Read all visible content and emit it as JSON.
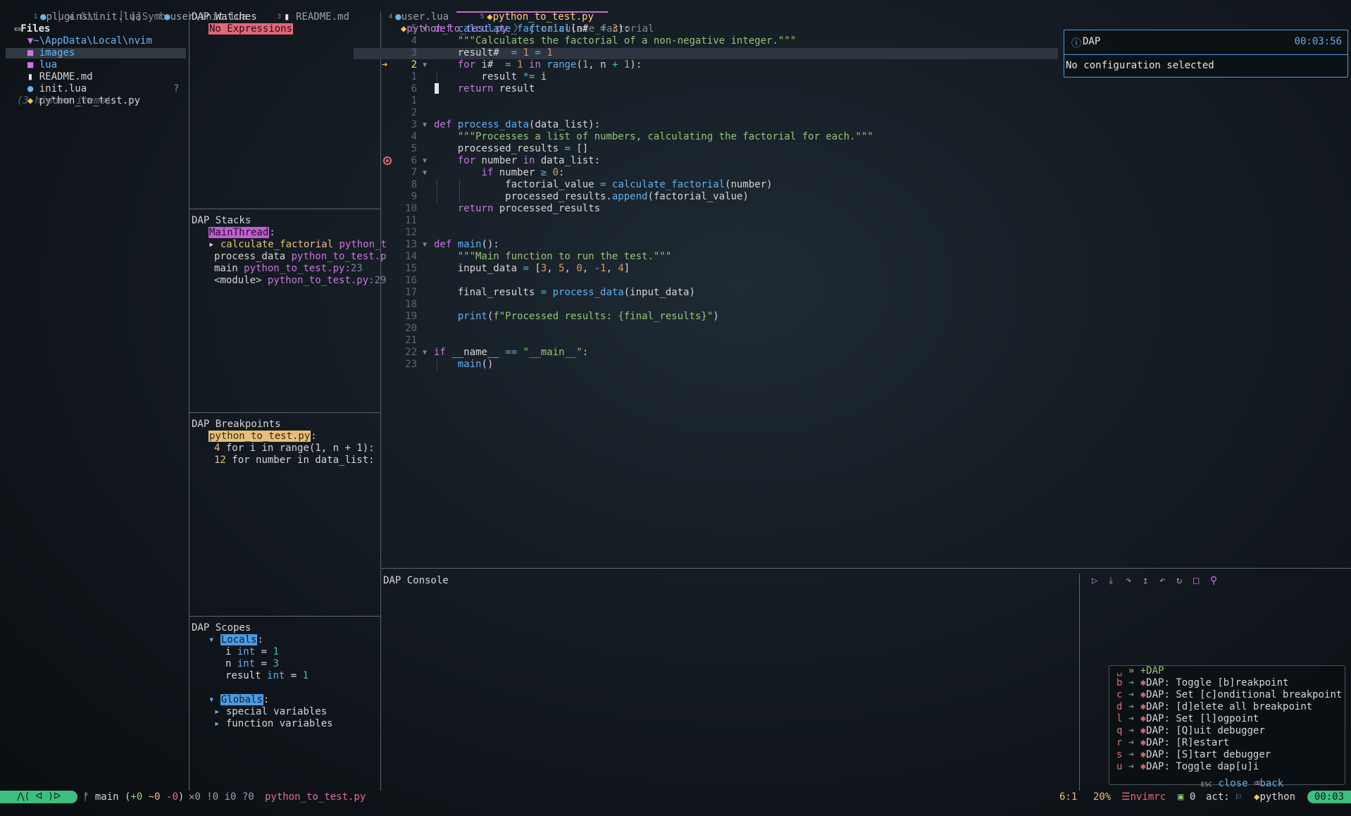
{
  "tabs": [
    {
      "num": "1",
      "icon": "lua-icon",
      "label": "plugins\\init.lua"
    },
    {
      "num": "2",
      "icon": "lua-icon",
      "label": "user\\init.lua"
    },
    {
      "num": "3",
      "icon": "file-icon",
      "label": "README.md"
    },
    {
      "num": "4",
      "icon": "lua-icon",
      "label": "user.lua"
    },
    {
      "num": "5",
      "icon": "python-icon",
      "label": "python_to_test.py"
    }
  ],
  "explorer": {
    "tabs": {
      "files": "Files",
      "git": "Git",
      "symbols": "Symb"
    },
    "root": "~\\AppData\\Local\\nvim",
    "items": [
      {
        "label": "images",
        "icon": "folder-icon"
      },
      {
        "label": "lua",
        "icon": "folder-icon"
      },
      {
        "label": "README.md",
        "icon": "file-icon"
      },
      {
        "label": "init.lua",
        "icon": "lua-icon"
      },
      {
        "label": "python_to_test.py",
        "icon": "python-icon",
        "status": "?"
      }
    ],
    "hidden": "(3 hidden items)"
  },
  "watches": {
    "title": "DAP Watches",
    "empty": "No Expressions"
  },
  "stacks": {
    "title": "DAP Stacks",
    "thread": "MainThread",
    "frames": [
      {
        "name": "calculate_factorial",
        "file": "python_t"
      },
      {
        "name": "process_data",
        "file": "python_to_test.p"
      },
      {
        "name": "main",
        "file": "python_to_test.py:",
        "line": "23"
      },
      {
        "name": "<module>",
        "file": "python_to_test.py:",
        "line": "29"
      }
    ]
  },
  "breakpoints": {
    "title": "DAP Breakpoints",
    "file": "python_to_test.py",
    "items": [
      {
        "line": "4",
        "code": "for i in range(1, n + 1):"
      },
      {
        "line": "12",
        "code": "for number in data_list:"
      }
    ]
  },
  "scopes": {
    "title": "DAP Scopes",
    "locals_label": "Locals",
    "locals": [
      {
        "name": "i",
        "type": "int",
        "value": "1"
      },
      {
        "name": "n",
        "type": "int",
        "value": "3"
      },
      {
        "name": "result",
        "type": "int",
        "value": "1"
      }
    ],
    "globals_label": "Globals",
    "globals": [
      "special variables",
      "function variables"
    ]
  },
  "breadcrumb": {
    "file": "python_to_test.py",
    "symbol": "calculate_factorial"
  },
  "editor": {
    "lines": [
      {
        "n": "5",
        "code": "def calculate_factorial(n#  = 3):"
      },
      {
        "n": "4",
        "code": "    \"\"\"Calculates the factorial of a non-negative integer.\"\"\""
      },
      {
        "n": "3",
        "code": "    result#  = 1 = 1"
      },
      {
        "n": "2",
        "code": "    for i#  = 1 in range(1, n + 1):"
      },
      {
        "n": "1",
        "code": "        result *= i"
      },
      {
        "n": "6",
        "code": "    return result"
      },
      {
        "n": "1",
        "code": ""
      },
      {
        "n": "2",
        "code": ""
      },
      {
        "n": "3",
        "code": "def process_data(data_list):"
      },
      {
        "n": "4",
        "code": "    \"\"\"Processes a list of numbers, calculating the factorial for each.\"\"\""
      },
      {
        "n": "5",
        "code": "    processed_results = []"
      },
      {
        "n": "6",
        "code": "    for number in data_list:"
      },
      {
        "n": "7",
        "code": "        if number ≥ 0:"
      },
      {
        "n": "8",
        "code": "            factorial_value = calculate_factorial(number)"
      },
      {
        "n": "9",
        "code": "            processed_results.append(factorial_value)"
      },
      {
        "n": "10",
        "code": "    return processed_results"
      },
      {
        "n": "11",
        "code": ""
      },
      {
        "n": "12",
        "code": ""
      },
      {
        "n": "13",
        "code": "def main():"
      },
      {
        "n": "14",
        "code": "    \"\"\"Main function to run the test.\"\"\""
      },
      {
        "n": "15",
        "code": "    input_data = [3, 5, 0, -1, 4]"
      },
      {
        "n": "16",
        "code": ""
      },
      {
        "n": "17",
        "code": "    final_results = process_data(input_data)"
      },
      {
        "n": "18",
        "code": ""
      },
      {
        "n": "19",
        "code": "    print(f\"Processed results: {final_results}\")"
      },
      {
        "n": "20",
        "code": ""
      },
      {
        "n": "21",
        "code": ""
      },
      {
        "n": "22",
        "code": "if __name__ == \"__main__\":"
      },
      {
        "n": "23",
        "code": "    main()"
      }
    ]
  },
  "notification": {
    "title": "DAP",
    "time": "00:03:56",
    "message": "No configuration selected"
  },
  "console": {
    "title": "DAP Console"
  },
  "whichkey": {
    "header": "» +DAP",
    "items": [
      {
        "key": "b",
        "label": "DAP: Toggle [b]reakpoint"
      },
      {
        "key": "c",
        "label": "DAP: Set [c]onditional breakpoint"
      },
      {
        "key": "d",
        "label": "DAP: [d]elete all breakpoint"
      },
      {
        "key": "l",
        "label": "DAP: Set [l]ogpoint"
      },
      {
        "key": "q",
        "label": "DAP: [Q]uit debugger"
      },
      {
        "key": "r",
        "label": "DAP: [R]estart"
      },
      {
        "key": "s",
        "label": "DAP: [S]tart debugger"
      },
      {
        "key": "u",
        "label": "DAP: Toggle dap[u]i"
      }
    ],
    "esc": "ESC",
    "close": "close",
    "back": "back"
  },
  "status": {
    "mode": "⋀( ᐊ )ᐅ",
    "branch": "main",
    "diff_add": "+0",
    "diff_mod": "~0",
    "diff_del": "-0",
    "diag": "✕0 !0 i0 ?0",
    "file": "python_to_test.py",
    "pos": "6:1",
    "percent": "20%",
    "project": "nvimrc",
    "jobs": "0",
    "act": "act:",
    "lang": "python",
    "time": "00:03"
  },
  "colors": {
    "accent": "#c678dd",
    "active_tab": "#ffcf80",
    "info": "#4d9be0",
    "error": "#e06c75",
    "mode_bg": "#3fbf7f"
  }
}
